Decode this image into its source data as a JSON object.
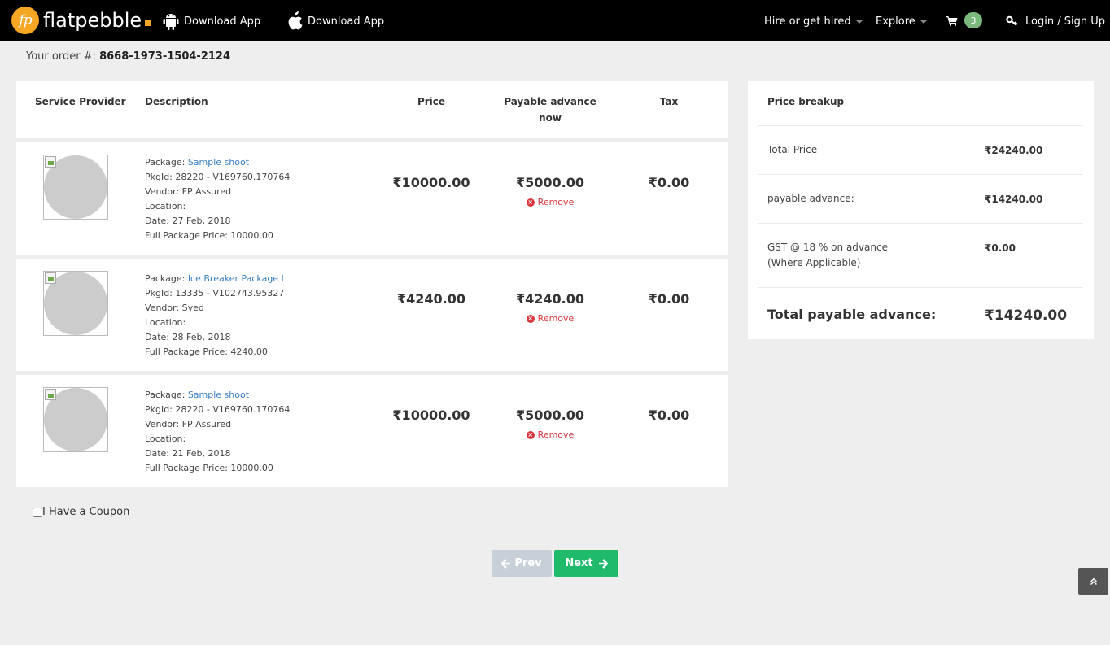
{
  "nav": {
    "brand": "flatpebble",
    "logo_initials": "fp",
    "android_app_label": "Download App",
    "ios_app_label": "Download App",
    "hire_label": "Hire or get hired",
    "explore_label": "Explore",
    "cart_count": "3",
    "login_label": "Login / Sign Up"
  },
  "order": {
    "prefix": "Your order #: ",
    "number": "8668-1973-1504-2124"
  },
  "table": {
    "headers": {
      "provider": "Service Provider",
      "description": "Description",
      "price": "Price",
      "payable_line1": "Payable advance",
      "payable_line2": "now",
      "tax": "Tax"
    },
    "rows": [
      {
        "package_label": "Package: ",
        "package_name": "Sample shoot",
        "pkg_id": "PkgId: 28220 - V169760.170764",
        "vendor": "Vendor: FP Assured",
        "location": "Location:",
        "date": "Date: 27 Feb, 2018",
        "full_price": "Full Package Price: 10000.00",
        "price": "₹10000.00",
        "payable": "₹5000.00",
        "remove": "Remove",
        "tax": "₹0.00"
      },
      {
        "package_label": "Package: ",
        "package_name": "Ice Breaker Package I",
        "pkg_id": "PkgId: 13335 - V102743.95327",
        "vendor": "Vendor: Syed",
        "location": "Location:",
        "date": "Date: 28 Feb, 2018",
        "full_price": "Full Package Price: 4240.00",
        "price": "₹4240.00",
        "payable": "₹4240.00",
        "remove": "Remove",
        "tax": "₹0.00"
      },
      {
        "package_label": "Package: ",
        "package_name": "Sample shoot",
        "pkg_id": "PkgId: 28220 - V169760.170764",
        "vendor": "Vendor: FP Assured",
        "location": "Location:",
        "date": "Date: 21 Feb, 2018",
        "full_price": "Full Package Price: 10000.00",
        "price": "₹10000.00",
        "payable": "₹5000.00",
        "remove": "Remove",
        "tax": "₹0.00"
      }
    ]
  },
  "breakup": {
    "title": "Price breakup",
    "total_price_label": "Total Price",
    "total_price_value": "₹24240.00",
    "payable_label": "payable advance:",
    "payable_value": "₹14240.00",
    "gst_label_line1": "GST @ 18 % on advance",
    "gst_label_line2": "(Where Applicable)",
    "gst_value": "₹0.00",
    "total_payable_label": "Total payable advance:",
    "total_payable_value": "₹14240.00"
  },
  "coupon_label": "I Have a Coupon",
  "buttons": {
    "prev": "Prev",
    "next": "Next"
  },
  "colors": {
    "nav_bg": "#000000",
    "brand_orange": "#f5a623",
    "link_blue": "#3a7fc1",
    "remove_red": "#d9363e",
    "next_green": "#1fba6a",
    "prev_disabled": "#c7d0d8"
  }
}
